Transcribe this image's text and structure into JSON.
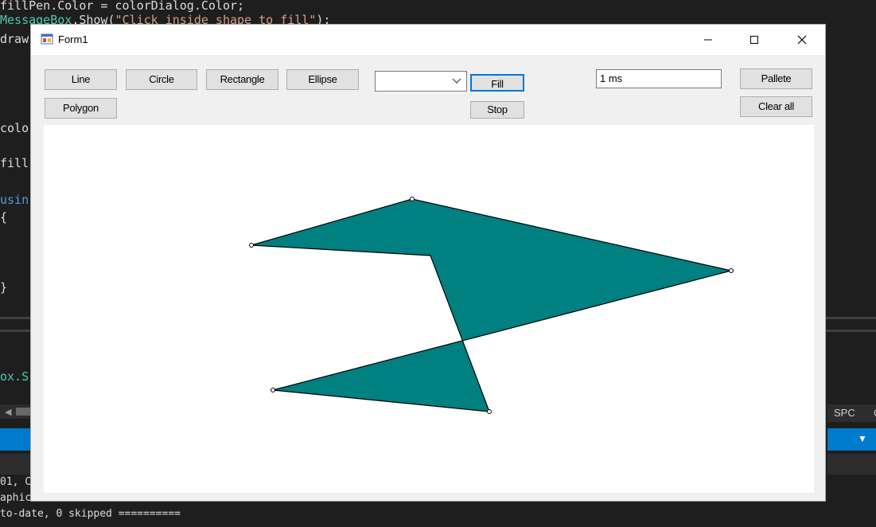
{
  "ide": {
    "code_lines": [
      "fillPen.Color = colorDialog.Color;",
      "MessageBox.Show(\"Click inside shape to fill\");",
      "draw",
      "colo",
      "fill",
      "usin",
      "{",
      "}",
      "ox.S"
    ],
    "right_tab": "SPC",
    "right_tab_extra": "C",
    "output_lines": [
      "01, Co",
      "aphic",
      "to-date, 0 skipped =========="
    ]
  },
  "form": {
    "title": "Form1",
    "caption_buttons": [
      "minimize",
      "maximize",
      "close"
    ],
    "buttons": {
      "line": "Line",
      "circle": "Circle",
      "rectangle": "Rectangle",
      "ellipse": "Ellipse",
      "polygon": "Polygon",
      "fill": "Fill",
      "stop": "Stop",
      "pallete": "Pallete",
      "clear_all": "Clear all"
    },
    "combo_value": "",
    "delay_value": "1 ms",
    "fill_color": "#008080",
    "outline_color": "#000000"
  },
  "drawing": {
    "type": "filled-polygon",
    "vertices_count": 6
  }
}
